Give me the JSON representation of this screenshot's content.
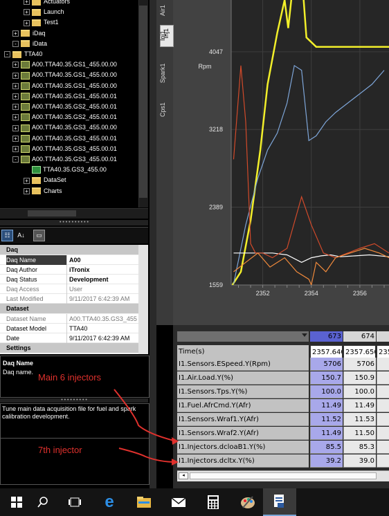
{
  "tree": {
    "rows": [
      {
        "label": "Actuators",
        "indent": 3,
        "kind": "folder",
        "exp": "+"
      },
      {
        "label": "Launch",
        "indent": 3,
        "kind": "folder",
        "exp": "+"
      },
      {
        "label": "Test1",
        "indent": 3,
        "kind": "folder",
        "exp": "+"
      },
      {
        "label": "iDaq",
        "indent": 0,
        "kind": "folder",
        "exp": "+"
      },
      {
        "label": "iData",
        "indent": 0,
        "kind": "folder",
        "exp": "-"
      },
      {
        "label": "TTA40",
        "indent": 1,
        "kind": "folder",
        "exp": "-"
      },
      {
        "label": "A00.TTA40.35.GS1_455.00.00",
        "indent": 2,
        "kind": "daq",
        "exp": "+"
      },
      {
        "label": "A00.TTA40.35.GS1_455.00.00",
        "indent": 2,
        "kind": "daq",
        "exp": "+"
      },
      {
        "label": "A00.TTA40.35.GS1_455.00.00",
        "indent": 2,
        "kind": "daq",
        "exp": "+"
      },
      {
        "label": "A00.TTA40.35.GS1_455.00.01",
        "indent": 2,
        "kind": "daq",
        "exp": "+"
      },
      {
        "label": "A00.TTA40.35.GS2_455.00.01",
        "indent": 2,
        "kind": "daq",
        "exp": "+"
      },
      {
        "label": "A00.TTA40.35.GS2_455.00.01",
        "indent": 2,
        "kind": "daq",
        "exp": "+"
      },
      {
        "label": "A00.TTA40.35.GS3_455.00.00",
        "indent": 2,
        "kind": "daq",
        "exp": "+"
      },
      {
        "label": "A00.TTA40.35.GS3_455.00.01",
        "indent": 2,
        "kind": "daq",
        "exp": "+"
      },
      {
        "label": "A00.TTA40.35.GS3_455.00.01",
        "indent": 2,
        "kind": "daq",
        "exp": "+"
      },
      {
        "label": "A00.TTA40.35.GS3_455.00.01",
        "indent": 2,
        "kind": "daq",
        "exp": "-"
      },
      {
        "label": "TTA40.35.GS3_455.00",
        "indent": 3,
        "kind": "grid",
        "exp": ""
      },
      {
        "label": "DataSet",
        "indent": 3,
        "kind": "folder",
        "exp": "+"
      },
      {
        "label": "Charts",
        "indent": 3,
        "kind": "folder",
        "exp": "+"
      }
    ]
  },
  "properties": {
    "groups": [
      {
        "name": "Daq",
        "rows": [
          {
            "name": "Daq Name",
            "value": "A00",
            "bold": true,
            "selected": true
          },
          {
            "name": "Daq Author",
            "value": "iTronix",
            "bold": true
          },
          {
            "name": "Daq Status",
            "value": "Development",
            "bold": true
          },
          {
            "name": "Daq Access",
            "value": "User",
            "dim": true
          },
          {
            "name": "Last Modified",
            "value": "9/11/2017 6:42:39 AM",
            "dim": true
          }
        ]
      },
      {
        "name": "Dataset",
        "rows": [
          {
            "name": "Dataset Name",
            "value": "A00.TTA40.35.GS3_455",
            "dim": true
          },
          {
            "name": "Dataset Model",
            "value": "TTA40"
          },
          {
            "name": "Date",
            "value": "9/11/2017 6:42:39 AM"
          }
        ]
      },
      {
        "name": "Settings",
        "rows": []
      }
    ]
  },
  "help": {
    "title": "Daq Name",
    "text": "Daq name."
  },
  "description": "Tune main data acquisition file for fuel and spark calibration development.",
  "annotations": {
    "main": "Main 6 injectors",
    "seventh": "7th injector"
  },
  "chart_tabs": [
    "Air1",
    "Inj1",
    "Spark1",
    "Cps1"
  ],
  "chart_data": {
    "type": "line",
    "ylabel": "Rpm",
    "yticks": [
      "4047",
      "3218",
      "2389",
      "1559"
    ],
    "xticks": [
      "2352",
      "2354",
      "2356"
    ],
    "ylim": [
      1559,
      4600
    ],
    "xlim": [
      2350.7,
      2357.2
    ],
    "grid": true,
    "series": [
      {
        "color": "#f2ef2a",
        "x": [
          2350.75,
          2351.1,
          2351.5,
          2351.9,
          2352.2,
          2352.6,
          2352.9,
          2353.05,
          2353.3,
          2353.6,
          2353.8,
          2354.2,
          2354.8,
          2355.4,
          2356.0,
          2356.8,
          2357.2
        ],
        "y": [
          1560,
          1700,
          2250,
          3000,
          3700,
          4250,
          4600,
          4300,
          4900,
          4900,
          4200,
          4100,
          4100,
          4100,
          4100,
          4100,
          4100
        ]
      },
      {
        "color": "#7ea6d9",
        "x": [
          2350.8,
          2351.3,
          2351.8,
          2352.2,
          2352.6,
          2353.0,
          2353.3,
          2353.6,
          2353.9,
          2354.2,
          2354.6,
          2355.0,
          2355.5,
          2356.0,
          2356.5,
          2357.0
        ],
        "y": [
          1570,
          2200,
          2700,
          3000,
          3180,
          3500,
          3900,
          3850,
          3100,
          3150,
          3300,
          3400,
          3500,
          3600,
          3700,
          3850
        ]
      },
      {
        "color": "#ffffff",
        "x": [
          2350.8,
          2351.6,
          2352.4,
          2353.0,
          2353.6,
          2354.0,
          2354.4,
          2354.8,
          2355.2,
          2355.8,
          2356.4,
          2357.2
        ],
        "y": [
          1900,
          1900,
          1900,
          1880,
          1800,
          1850,
          1870,
          1880,
          1860,
          1870,
          1880,
          1860
        ]
      },
      {
        "color": "#d24a2a",
        "x": [
          2350.8,
          2351.1,
          2351.3,
          2351.5,
          2351.7,
          2352.0,
          2352.4,
          2353.0,
          2353.6,
          2354.0,
          2354.5,
          2355.0,
          2355.5,
          2356.0,
          2356.6,
          2357.2
        ],
        "y": [
          2900,
          3900,
          3300,
          2000,
          1900,
          1900,
          1850,
          1950,
          2500,
          2200,
          1900,
          1850,
          1900,
          1950,
          2000,
          1900
        ]
      },
      {
        "color": "#f08a3c",
        "x": [
          2350.8,
          2351.3,
          2351.8,
          2352.3,
          2352.9,
          2353.4,
          2353.9,
          2354.0,
          2354.2,
          2354.6,
          2355.0,
          2355.6,
          2356.2,
          2356.8,
          2357.2
        ],
        "y": [
          1700,
          1800,
          1900,
          1750,
          1850,
          1700,
          1620,
          1560,
          1800,
          1700,
          1850,
          1900,
          1950,
          1900,
          1850
        ]
      }
    ]
  },
  "grid": {
    "col_headers": [
      "673",
      "674",
      ""
    ],
    "rows": [
      {
        "label": "Time(s)",
        "values": [
          "2357.640",
          "2357.650",
          "235"
        ]
      },
      {
        "label": "I1.Sensors.ESpeed.Y(Rpm)",
        "values": [
          "5706",
          "5706",
          ""
        ]
      },
      {
        "label": "I1.Air.Load.Y(%)",
        "values": [
          "150.7",
          "150.9",
          ""
        ]
      },
      {
        "label": "I1.Sensors.Tps.Y(%)",
        "values": [
          "100.0",
          "100.0",
          ""
        ]
      },
      {
        "label": "I1.Fuel.AfrCmd.Y(Afr)",
        "values": [
          "11.49",
          "11.49",
          ""
        ]
      },
      {
        "label": "I1.Sensors.Wraf1.Y(Afr)",
        "values": [
          "11.52",
          "11.53",
          ""
        ]
      },
      {
        "label": "I1.Sensors.Wraf2.Y(Afr)",
        "values": [
          "11.49",
          "11.50",
          ""
        ]
      },
      {
        "label": "I1.Injectors.dcloaB1.Y(%)",
        "values": [
          "85.5",
          "85.3",
          ""
        ]
      },
      {
        "label": "I1.Injectors.dcltx.Y(%)",
        "values": [
          "39.2",
          "39.0",
          ""
        ]
      }
    ]
  },
  "taskbar": {
    "icons": [
      "windows-start-icon",
      "search-icon",
      "task-view-icon",
      "edge-browser-icon",
      "file-explorer-icon",
      "mail-icon",
      "calculator-icon",
      "paint-icon",
      "itronix-app-icon"
    ]
  }
}
